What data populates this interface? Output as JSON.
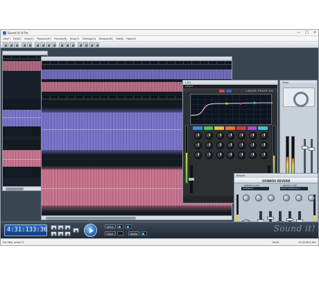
{
  "window": {
    "title": "Sound it! 8 Pro",
    "controls": [
      "—",
      "□",
      "✕"
    ]
  },
  "menu": {
    "items": [
      "File(F)",
      "Edit(E)",
      "View(V)",
      "Playback(P)",
      "Process(R)",
      "Tools(T)",
      "Settings(S)",
      "Window(W)",
      "Tab(B)",
      "Help(H)"
    ]
  },
  "toolbar": {
    "icons": [
      "new-file-icon",
      "open-folder-icon",
      "save-icon",
      "undo-icon",
      "redo-icon",
      "cut-icon",
      "copy-icon",
      "paste-icon",
      "delete-icon",
      "select-icon",
      "zoom-in-icon",
      "zoom-out-icon",
      "marker-icon",
      "pencil-icon",
      "snap-icon",
      "loop-icon"
    ]
  },
  "eq_plugin": {
    "title": "L-EQ",
    "preset_bar": "Default",
    "brand_name": "LINEAR PHASE EQ",
    "band_colors": [
      "#3c8fd6",
      "#4fc25a",
      "#e0c23a",
      "#e07a2c",
      "#d6374a",
      "#b04ad6",
      "#3ec2d6"
    ]
  },
  "mixer": {
    "title": "Mixer"
  },
  "reverb": {
    "title": "Reverb",
    "name": "SONNOX REVERB",
    "preset_class_label": "PRESET CLASS",
    "preset_class_value": "Ambience",
    "preset_type_label": "PRESET TYPE",
    "preset_type_value": "Drum Ambience 1"
  },
  "transport": {
    "time": "4:31:133:36",
    "effect_label": "Effect",
    "timer_label": "Timer",
    "media_label": "Media",
    "logo": "Sound it!"
  },
  "status": {
    "left": "For Help, press F1",
    "mid": "Small",
    "right": "22:02:48.0 Sec"
  }
}
